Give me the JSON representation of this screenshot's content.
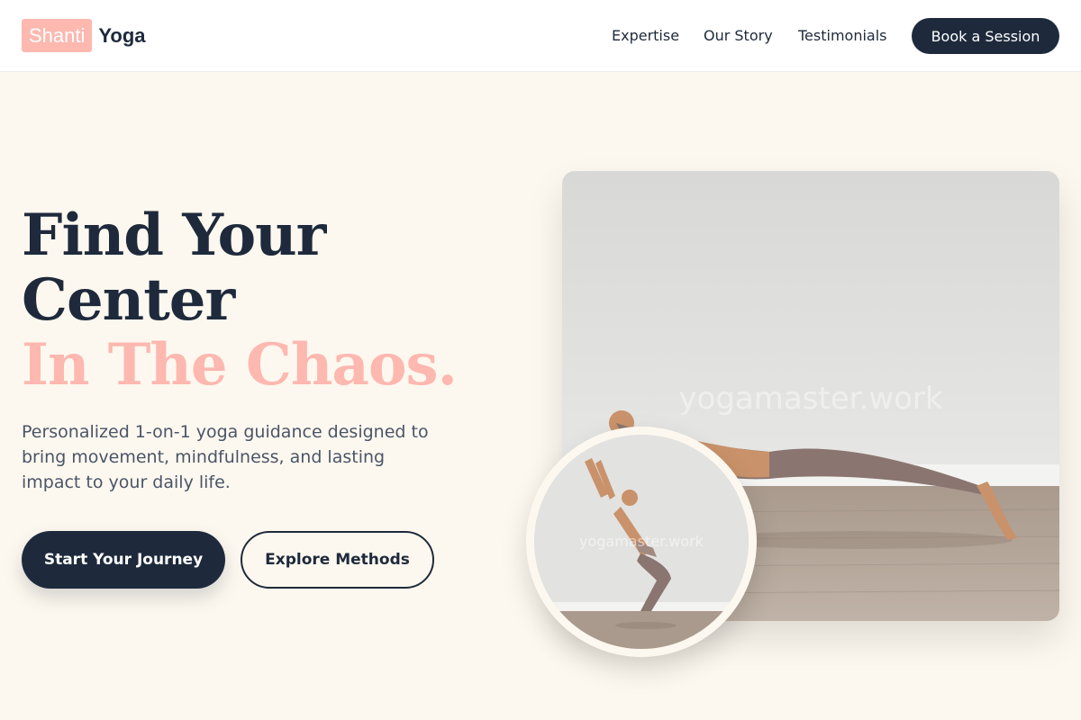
{
  "brand": {
    "mark": "Shanti",
    "word": "Yoga",
    "accent_color": "#fdb8b0",
    "dark_color": "#1e2a3c"
  },
  "nav": {
    "links": [
      "Expertise",
      "Our Story",
      "Testimonials"
    ],
    "cta": "Book a Session"
  },
  "hero": {
    "title_line1": "Find Your",
    "title_line2": "Center",
    "title_accent": "In The Chaos.",
    "description": "Personalized 1-on-1 yoga guidance designed to bring movement, mindfulness, and lasting impact to your daily life.",
    "primary_button": "Start Your Journey",
    "secondary_button": "Explore Methods"
  },
  "images": {
    "main_watermark": "yogamaster.work",
    "inset_watermark": "yogamaster.work",
    "main_subject": "plank-pose-photo",
    "inset_subject": "chair-pose-photo"
  }
}
